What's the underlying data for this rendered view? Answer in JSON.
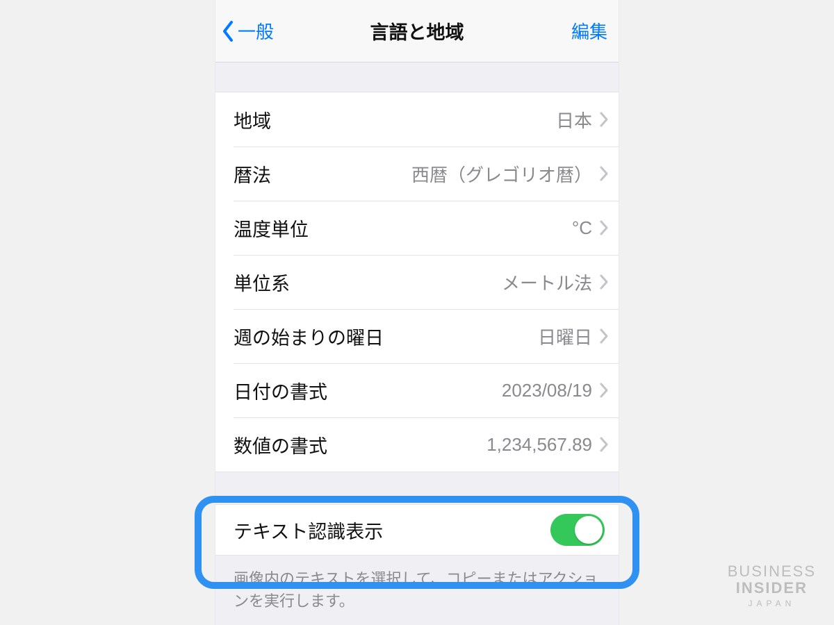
{
  "nav": {
    "back_label": "一般",
    "title": "言語と地域",
    "edit_label": "編集"
  },
  "rows": [
    {
      "label": "地域",
      "value": "日本"
    },
    {
      "label": "暦法",
      "value": "西暦（グレゴリオ暦）"
    },
    {
      "label": "温度単位",
      "value": "°C"
    },
    {
      "label": "単位系",
      "value": "メートル法"
    },
    {
      "label": "週の始まりの曜日",
      "value": "日曜日"
    },
    {
      "label": "日付の書式",
      "value": "2023/08/19"
    },
    {
      "label": "数値の書式",
      "value": "1,234,567.89"
    }
  ],
  "live_text": {
    "label": "テキスト認識表示",
    "enabled": true,
    "footer": "画像内のテキストを選択して、コピーまたはアクションを実行します。"
  },
  "watermark": {
    "line1": "BUSINESS",
    "line2": "INSIDER",
    "line3": "JAPAN"
  },
  "colors": {
    "tint": "#007aff",
    "switch_on": "#34c759",
    "highlight": "#2f91f2"
  }
}
